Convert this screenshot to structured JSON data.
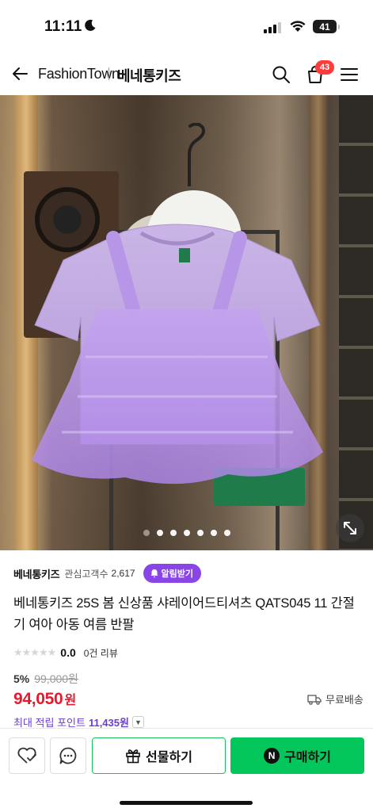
{
  "status": {
    "time": "11:11",
    "battery": "41"
  },
  "header": {
    "brand": "FashionTown",
    "store": "베네통키즈",
    "cart_count": "43"
  },
  "gallery": {
    "total_slides": 7,
    "active_index": 0
  },
  "product": {
    "store_name": "베네통키즈",
    "watchers_label": "관심고객수",
    "watchers_count": "2,617",
    "alarm_label": "알림받기",
    "title": "베네통키즈 25S 봄 신상품 샤레이어드티셔츠 QATS045 11 간절기 여아 아동 여름 반팔",
    "rating_score": "0.0",
    "stars": "★★★★★",
    "reviews_label": "0건 리뷰",
    "discount": "5%",
    "original_price": "99,000원",
    "price": "94,050",
    "currency": "원",
    "shipping_label": "무료배송",
    "points_label": "최대 적립 포인트",
    "points_value": "11,435원"
  },
  "actions": {
    "gift_label": "선물하기",
    "buy_label": "구매하기",
    "naver_badge": "N"
  },
  "colors": {
    "accent_green": "#03c75a",
    "price_red": "#e8182d",
    "alarm_purple": "#8a45e6",
    "points_purple": "#6c3fd1"
  }
}
